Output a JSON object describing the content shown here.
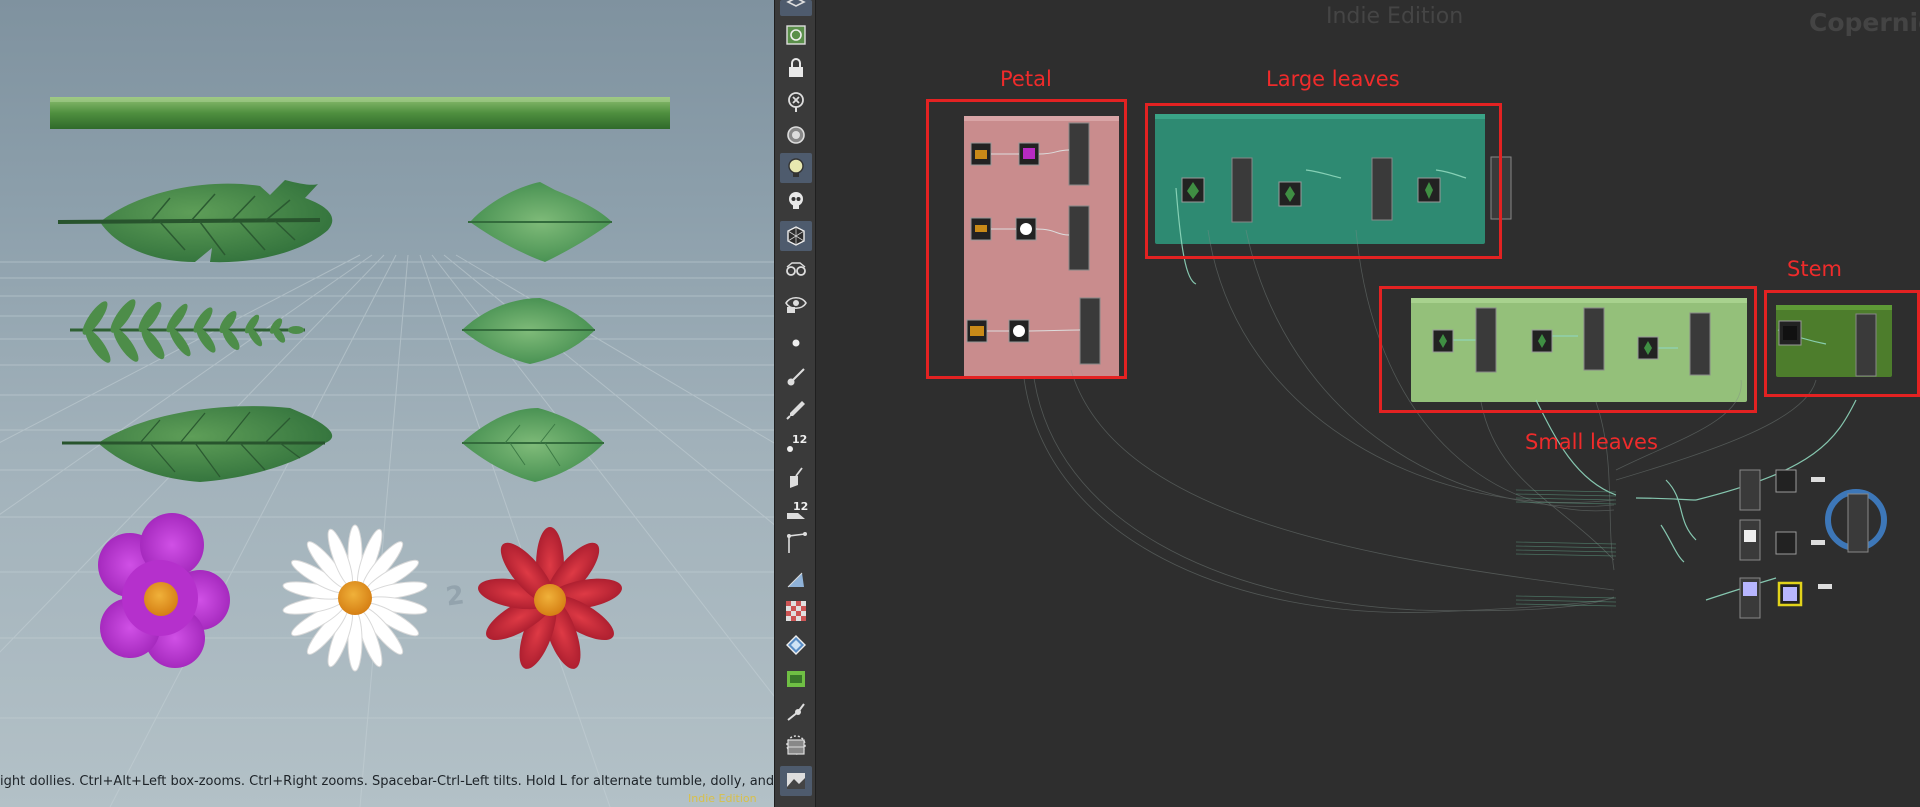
{
  "viewport": {
    "status_text": "ight dollies. Ctrl+Alt+Left box-zooms. Ctrl+Right zooms. Spacebar-Ctrl-Left tilts. Hold L for alternate tumble, dolly, and zoom. M for",
    "edition_label": "Indie Edition",
    "grid_digits": [
      "2"
    ]
  },
  "toolbar": {
    "items": [
      {
        "name": "select-icon",
        "active": true
      },
      {
        "name": "view-icon",
        "active": false
      },
      {
        "name": "lock-icon",
        "active": false
      },
      {
        "name": "hide-icon",
        "active": false
      },
      {
        "name": "light-bulb-icon",
        "active": false
      },
      {
        "name": "light-bulb-lit-icon",
        "active": true
      },
      {
        "name": "skull-icon",
        "active": false
      },
      {
        "name": "shaded-cube-icon",
        "active": true
      },
      {
        "name": "glasses-icon",
        "active": false
      },
      {
        "name": "render-eye-icon",
        "active": false
      },
      {
        "name": "point-icon",
        "active": false
      },
      {
        "name": "brush-icon",
        "active": false
      },
      {
        "name": "pen-icon",
        "active": false
      },
      {
        "name": "point-numbers-icon",
        "active": false,
        "label": "12"
      },
      {
        "name": "shovel-icon",
        "active": false
      },
      {
        "name": "primitive-numbers-icon",
        "active": false,
        "label": "12"
      },
      {
        "name": "edge-angle-icon",
        "active": false
      },
      {
        "name": "triangle-icon",
        "active": false
      },
      {
        "name": "checker-icon",
        "active": false
      },
      {
        "name": "uv-icon",
        "active": false
      },
      {
        "name": "green-frame-icon",
        "active": false
      },
      {
        "name": "snap-icon",
        "active": false
      },
      {
        "name": "circle-dashed-icon",
        "active": false
      },
      {
        "name": "background-icon",
        "active": false
      },
      {
        "name": "image-icon",
        "active": true
      }
    ]
  },
  "network": {
    "edition_label": "Indie Edition",
    "context_label": "Copernic",
    "annotations": [
      {
        "label": "Petal",
        "color": "#e32222"
      },
      {
        "label": "Large leaves",
        "color": "#e32222"
      },
      {
        "label": "Stem",
        "color": "#e32222"
      },
      {
        "label": "Small leaves",
        "color": "#e32222"
      }
    ],
    "colors": {
      "petal_box": "#c98c8d",
      "large_leaves_box": "#2e8a72",
      "small_leaves_box": "#94c07a",
      "stem_box": "#4d7d2c",
      "wire": "#8fd7bd",
      "selected_node": "#e2d31b",
      "display_ring": "#3d77b8"
    }
  }
}
